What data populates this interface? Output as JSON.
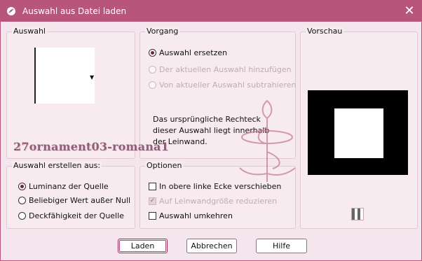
{
  "window": {
    "title": "Auswahl aus Datei laden",
    "close_label": "✕",
    "accent": "#b7557a"
  },
  "groups": {
    "auswahl": {
      "title": "Auswahl"
    },
    "vorgang": {
      "title": "Vorgang"
    },
    "vorschau": {
      "title": "Vorschau"
    },
    "erstellen": {
      "title": "Auswahl erstellen aus:"
    },
    "optionen": {
      "title": "Optionen"
    }
  },
  "vorgang": {
    "items": [
      {
        "label": "Auswahl ersetzen",
        "checked": true,
        "disabled": false
      },
      {
        "label": "Der aktuellen Auswahl hinzufügen",
        "checked": false,
        "disabled": true
      },
      {
        "label": "Von aktueller Auswahl subtrahieren",
        "checked": false,
        "disabled": true
      }
    ],
    "note": "Das ursprüngliche Rechteck dieser Auswahl liegt innerhalb der Leinwand."
  },
  "watermark": "27ornament03-romana1",
  "erstellen": {
    "items": [
      {
        "label": "Luminanz der Quelle",
        "checked": true
      },
      {
        "label": "Beliebiger Wert außer Null",
        "checked": false
      },
      {
        "label": "Deckfähigkeit der Quelle",
        "checked": false
      }
    ]
  },
  "optionen": {
    "items": [
      {
        "label": "In obere linke Ecke verschieben",
        "checked": false,
        "disabled": false
      },
      {
        "label": "Auf Leinwandgröße reduzieren",
        "checked": true,
        "disabled": true
      },
      {
        "label": "Auswahl umkehren",
        "checked": false,
        "disabled": false
      }
    ]
  },
  "buttons": {
    "load": "Laden",
    "cancel": "Abbrechen",
    "help": "Hilfe"
  },
  "icons": {
    "app": "paintbrush-icon",
    "close": "close-icon",
    "dropdown": "dropdown-arrow-icon",
    "checker": "transparency-checker-icon"
  }
}
